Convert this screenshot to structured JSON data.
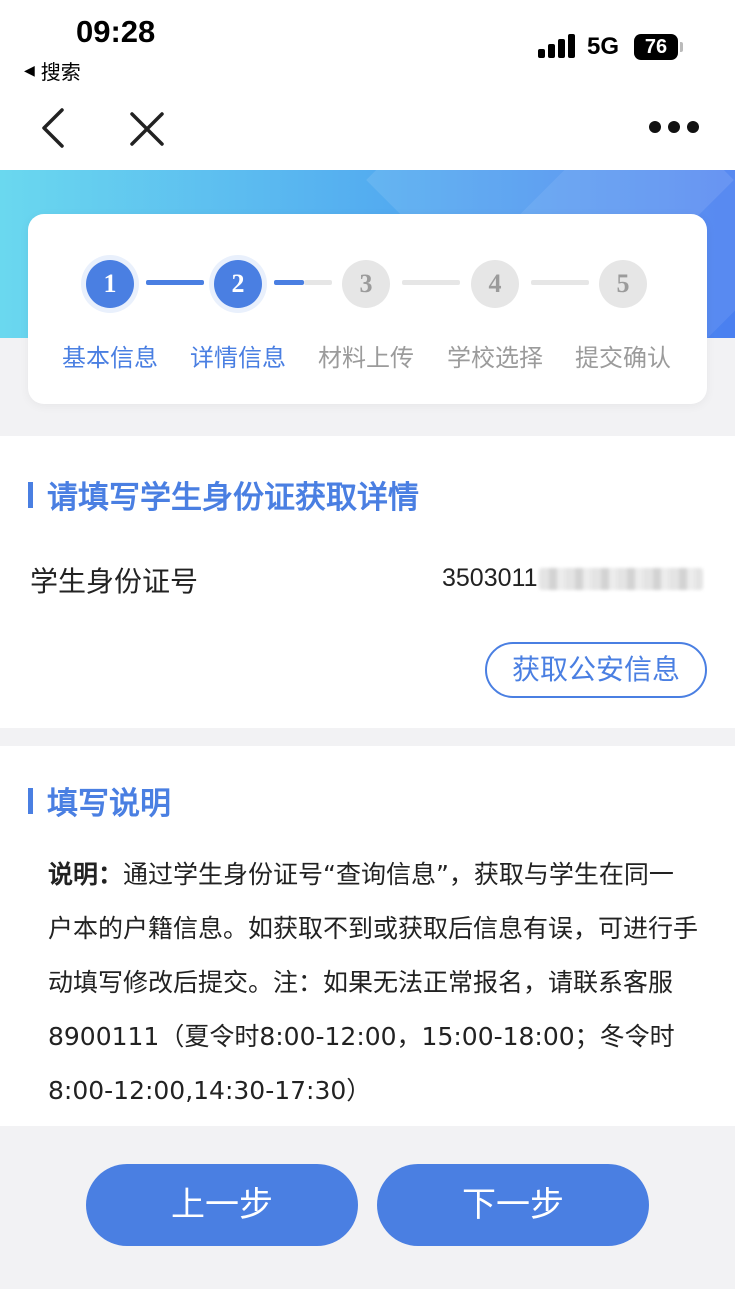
{
  "status_bar": {
    "time": "09:28",
    "back_app": "搜索",
    "network": "5G",
    "battery": "76"
  },
  "nav": {
    "back_icon": "chevron-left-icon",
    "close_icon": "close-icon",
    "more_icon": "more-dots-icon"
  },
  "steps": [
    {
      "number": "1",
      "label": "基本信息",
      "state": "active"
    },
    {
      "number": "2",
      "label": "详情信息",
      "state": "active"
    },
    {
      "number": "3",
      "label": "材料上传",
      "state": "inactive"
    },
    {
      "number": "4",
      "label": "学校选择",
      "state": "inactive"
    },
    {
      "number": "5",
      "label": "提交确认",
      "state": "inactive"
    }
  ],
  "id_section": {
    "title": "请填写学生身份证获取详情",
    "id_label": "学生身份证号",
    "id_value": "3503011",
    "fetch_button": "获取公安信息"
  },
  "instructions": {
    "title": "填写说明",
    "label": "说明：",
    "text": "通过学生身份证号“查询信息”，获取与学生在同一户本的户籍信息。如获取不到或获取后信息有误，可进行手动填写修改后提交。注：如果无法正常报名，请联系客服8900111（夏令时8:00-12:00，15:00-18:00；冬令时8:00-12:00,14:30-17:30）"
  },
  "buttons": {
    "prev": "上一步",
    "next": "下一步"
  },
  "colors": {
    "accent": "#4a7fe2",
    "inactive": "#9b9b9b"
  }
}
